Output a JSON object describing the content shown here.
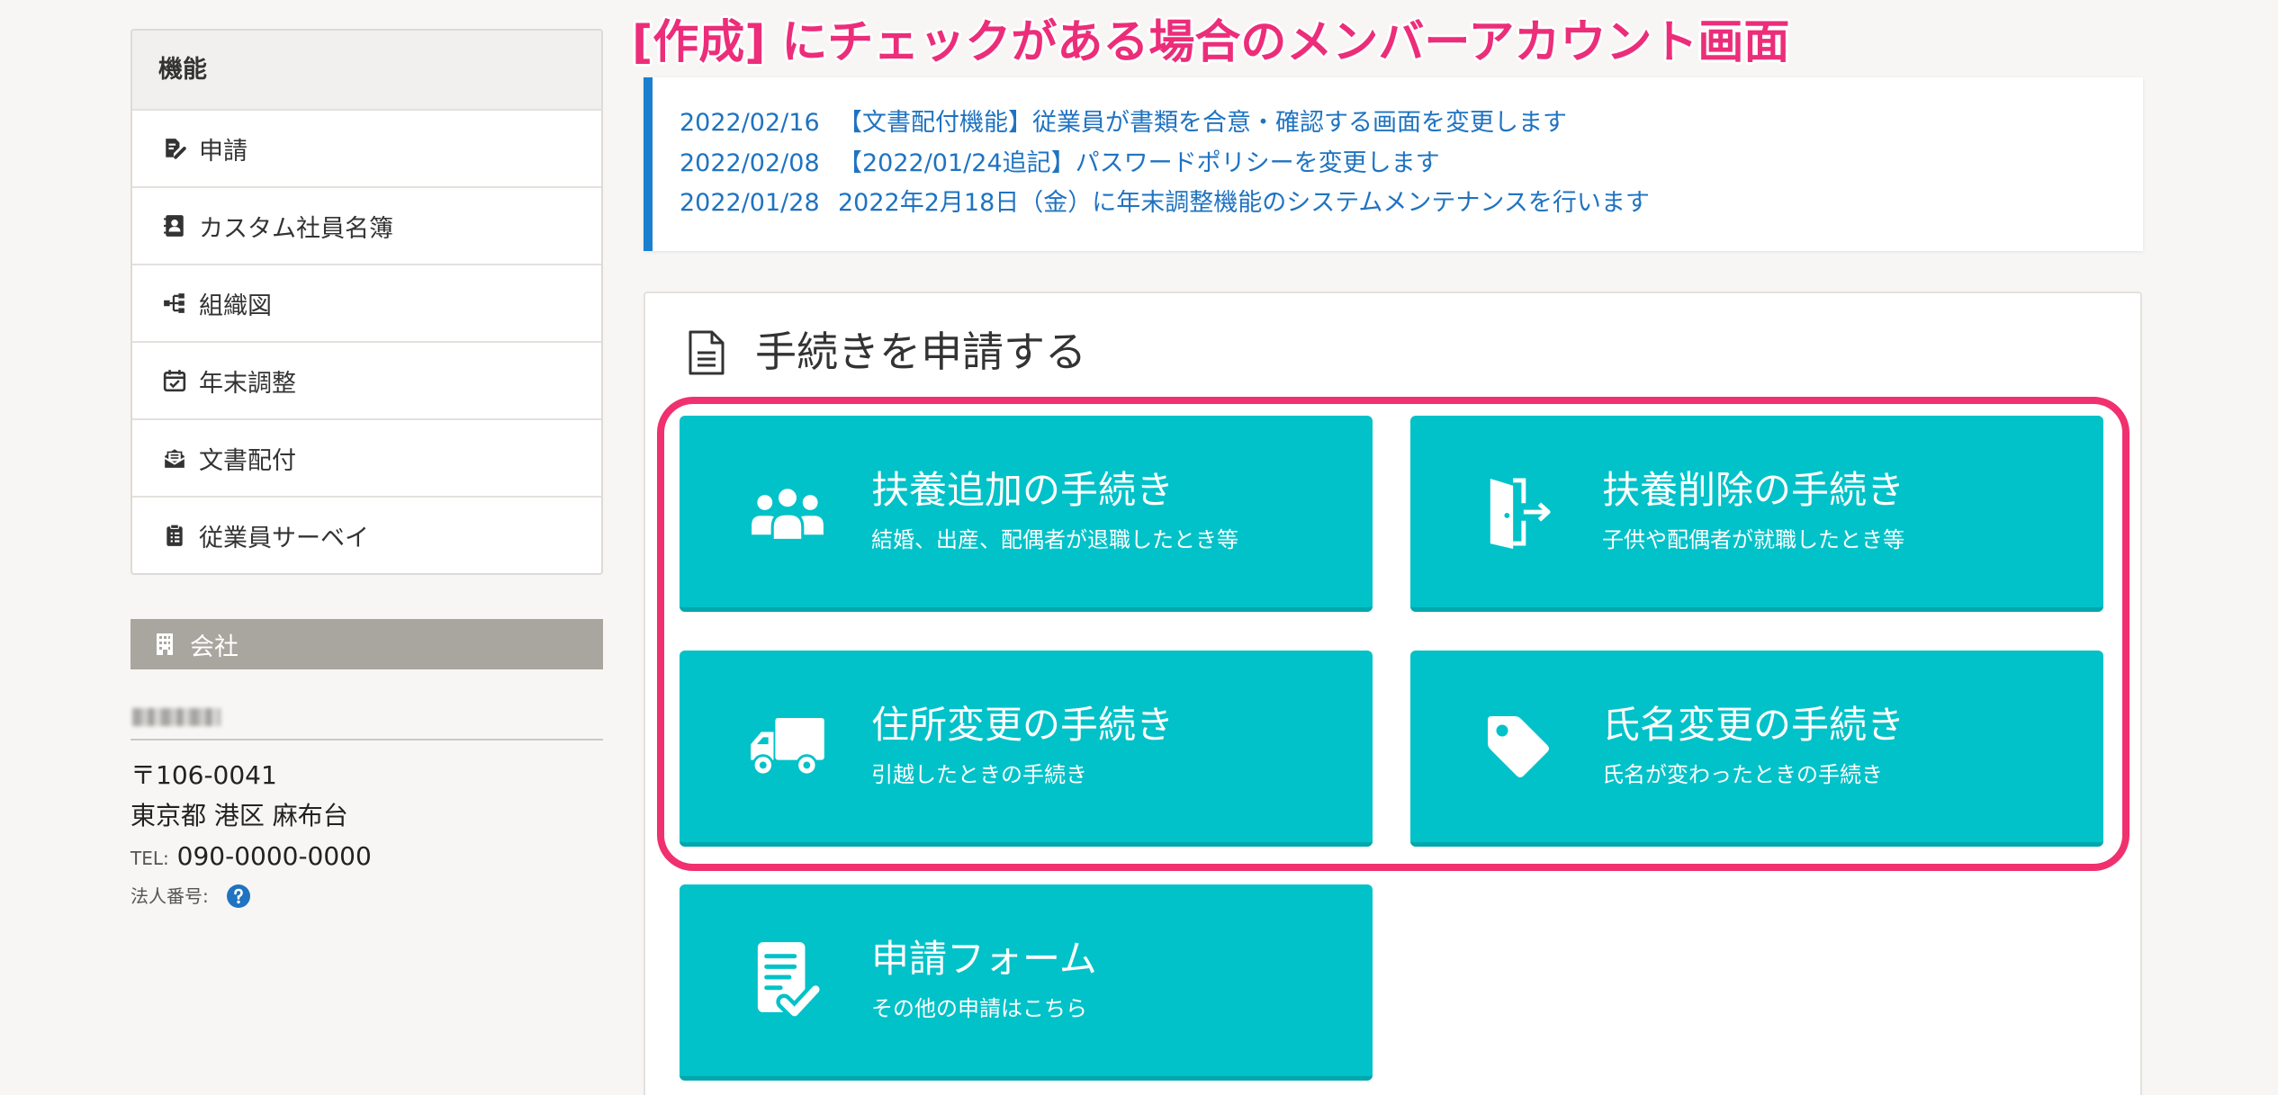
{
  "annotation": {
    "title": "[作成] にチェックがある場合のメンバーアカウント画面"
  },
  "sidebar": {
    "header": "機能",
    "items": [
      {
        "label": "申請",
        "icon": "file-signature-icon"
      },
      {
        "label": "カスタム社員名簿",
        "icon": "address-book-icon"
      },
      {
        "label": "組織図",
        "icon": "sitemap-icon"
      },
      {
        "label": "年末調整",
        "icon": "calendar-check-icon"
      },
      {
        "label": "文書配付",
        "icon": "envelope-open-text-icon"
      },
      {
        "label": "従業員サーベイ",
        "icon": "clipboard-list-icon"
      }
    ]
  },
  "company": {
    "header": "会社",
    "header_icon": "building-icon",
    "postal": "〒106-0041",
    "address": "東京都 港区 麻布台",
    "tel_label": "TEL:",
    "tel": "090-0000-0000",
    "corp_number_label": "法人番号:",
    "help_icon": "help-icon"
  },
  "notices": [
    {
      "date": "2022/02/16",
      "text": "【文書配付機能】従業員が書類を合意・確認する画面を変更します"
    },
    {
      "date": "2022/02/08",
      "text": "【2022/01/24追記】パスワードポリシーを変更します"
    },
    {
      "date": "2022/01/28",
      "text": "2022年2月18日（金）に年末調整機能のシステムメンテナンスを行います"
    }
  ],
  "procedures": {
    "heading": "手続きを申請する",
    "heading_icon": "document-icon",
    "tiles": [
      {
        "title": "扶養追加の手続き",
        "subtitle": "結婚、出産、配偶者が退職したとき等",
        "icon": "users-icon"
      },
      {
        "title": "扶養削除の手続き",
        "subtitle": "子供や配偶者が就職したとき等",
        "icon": "door-exit-icon"
      },
      {
        "title": "住所変更の手続き",
        "subtitle": "引越したときの手続き",
        "icon": "truck-icon"
      },
      {
        "title": "氏名変更の手続き",
        "subtitle": "氏名が変わったときの手続き",
        "icon": "tag-icon"
      },
      {
        "title": "申請フォーム",
        "subtitle": "その他の申請はこちら",
        "icon": "file-check-icon"
      }
    ]
  },
  "colors": {
    "tile": "#00c2c8",
    "notice_accent": "#1b7fd0",
    "link_text": "#1f73c1",
    "highlight": "#f0306f",
    "annotation": "#ec2d7a",
    "company_bar": "#a9a69f",
    "background": "#f7f6f4"
  }
}
